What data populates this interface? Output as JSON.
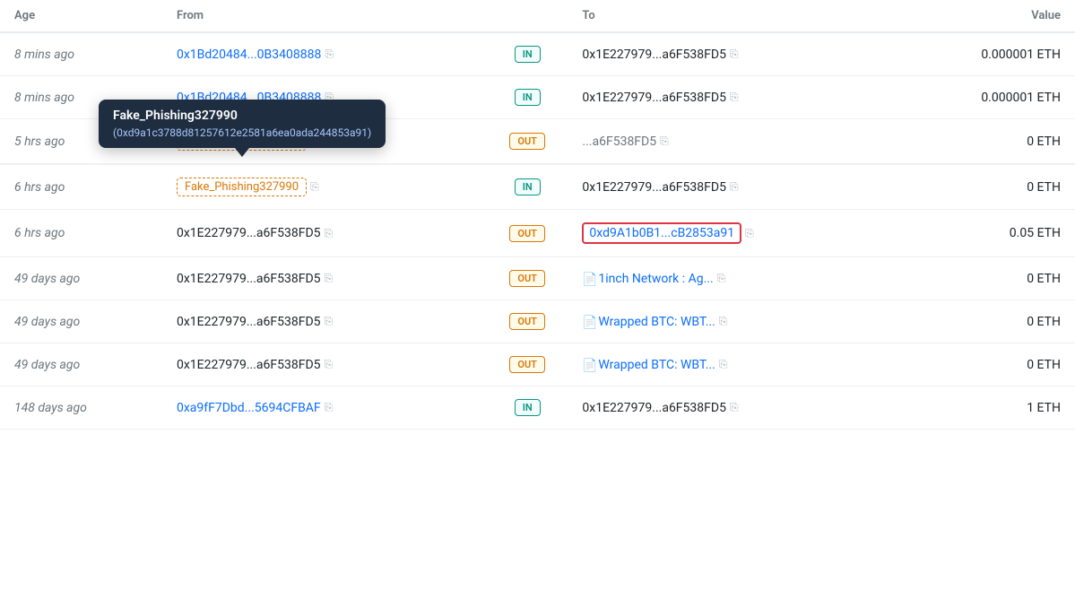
{
  "columns": {
    "age": "Age",
    "from": "From",
    "to": "To",
    "value": "Value"
  },
  "rows": [
    {
      "id": "row1",
      "age": "8 mins ago",
      "from": "0x1Bd20484...0B3408888",
      "from_link": true,
      "direction": "IN",
      "to": "0x1E227979...a6F538FD5",
      "to_link": false,
      "to_contract": false,
      "to_highlighted": false,
      "value": "0.000001 ETH"
    },
    {
      "id": "row2",
      "age": "8 mins ago",
      "from": "0x1Bd20484...0B3408888",
      "from_link": true,
      "direction": "IN",
      "to": "0x1E227979...a6F538FD5",
      "to_link": false,
      "to_contract": false,
      "to_highlighted": false,
      "value": "0.000001 ETH"
    },
    {
      "id": "row3",
      "age": "5 hrs ago",
      "from": "Fake_Phishing327990",
      "from_link": false,
      "from_phishing": true,
      "direction": "OUT",
      "to": "0x1E227979...a6F538FD5",
      "to_truncated": true,
      "to_link": false,
      "to_contract": false,
      "to_highlighted": false,
      "has_tooltip": true,
      "tooltip_title": "Fake_Phishing327990",
      "tooltip_addr": "(0xd9a1c3788d81257612e2581a6ea0ada244853a91)",
      "value": "0 ETH"
    },
    {
      "id": "row4",
      "age": "6 hrs ago",
      "from": "Fake_Phishing327990",
      "from_link": false,
      "from_phishing": true,
      "direction": "IN",
      "to": "0x1E227979...a6F538FD5",
      "to_link": false,
      "to_contract": false,
      "to_highlighted": false,
      "value": "0 ETH"
    },
    {
      "id": "row5",
      "age": "6 hrs ago",
      "from": "0x1E227979...a6F538FD5",
      "from_link": false,
      "direction": "OUT",
      "to": "0xd9A1b0B1...cB2853a91",
      "to_link": true,
      "to_contract": false,
      "to_highlighted": true,
      "value": "0.05 ETH"
    },
    {
      "id": "row6",
      "age": "49 days ago",
      "from": "0x1E227979...a6F538FD5",
      "from_link": false,
      "direction": "OUT",
      "to": "1inch Network : Ag...",
      "to_link": true,
      "to_contract": true,
      "to_highlighted": false,
      "value": "0 ETH"
    },
    {
      "id": "row7",
      "age": "49 days ago",
      "from": "0x1E227979...a6F538FD5",
      "from_link": false,
      "direction": "OUT",
      "to": "Wrapped BTC: WBT...",
      "to_link": true,
      "to_contract": true,
      "to_highlighted": false,
      "value": "0 ETH"
    },
    {
      "id": "row8",
      "age": "49 days ago",
      "from": "0x1E227979...a6F538FD5",
      "from_link": false,
      "direction": "OUT",
      "to": "Wrapped BTC: WBT...",
      "to_link": true,
      "to_contract": true,
      "to_highlighted": false,
      "value": "0 ETH"
    },
    {
      "id": "row9",
      "age": "148 days ago",
      "from": "0xa9fF7Dbd...5694CFBAF",
      "from_link": true,
      "direction": "IN",
      "to": "0x1E227979...a6F538FD5",
      "to_link": false,
      "to_contract": false,
      "to_highlighted": false,
      "value": "1 ETH"
    }
  ],
  "tooltip": {
    "title": "Fake_Phishing327990",
    "addr": "(0xd9a1c3788d81257612e2581a6ea0ada244853a91)"
  }
}
